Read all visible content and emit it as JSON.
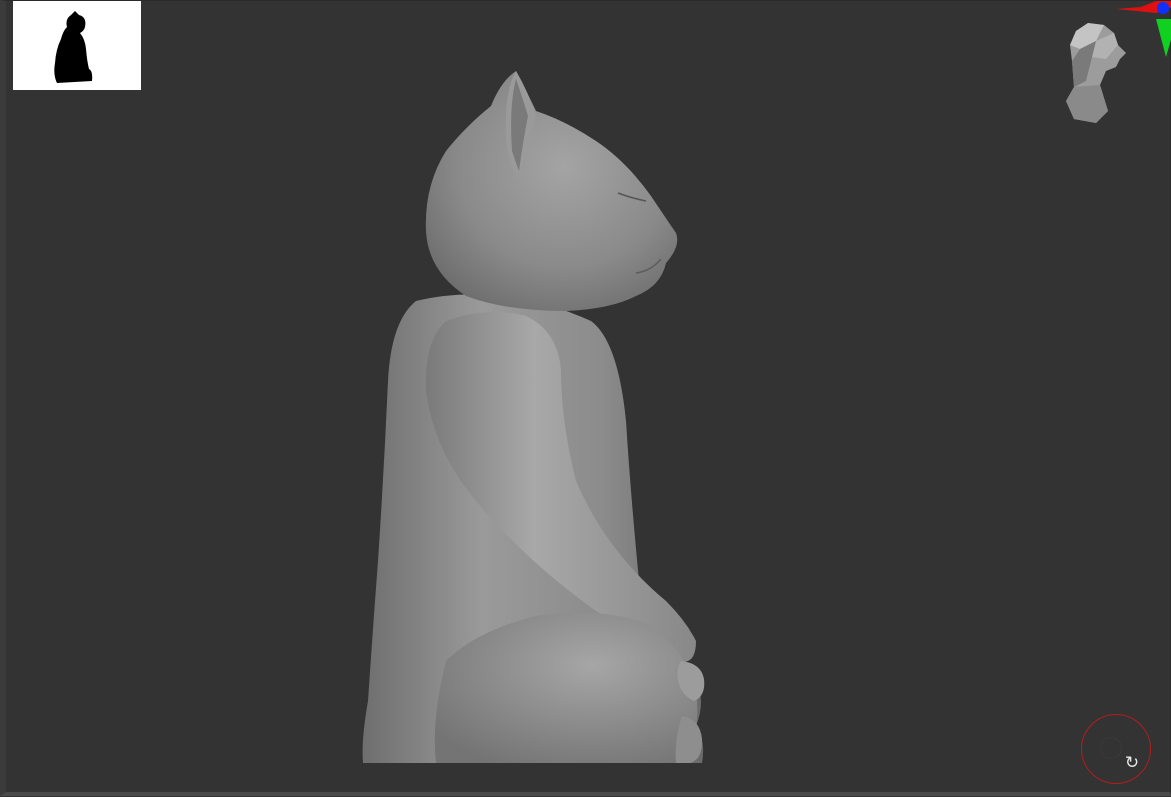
{
  "viewport": {
    "background_color": "#333333",
    "model_color": "#8a8a8a"
  },
  "thumbnail": {
    "background_color": "#ffffff",
    "silhouette_color": "#000000",
    "icon": "cat-silhouette-icon"
  },
  "navigation": {
    "head_icon": "nav-head-icon",
    "axis_colors": {
      "x": "#e01010",
      "y": "#10d020",
      "z": "#1030ff"
    }
  },
  "rotate_control": {
    "icon": "rotate-icon",
    "glyph": "↻",
    "ring_color": "#b31d1d"
  }
}
